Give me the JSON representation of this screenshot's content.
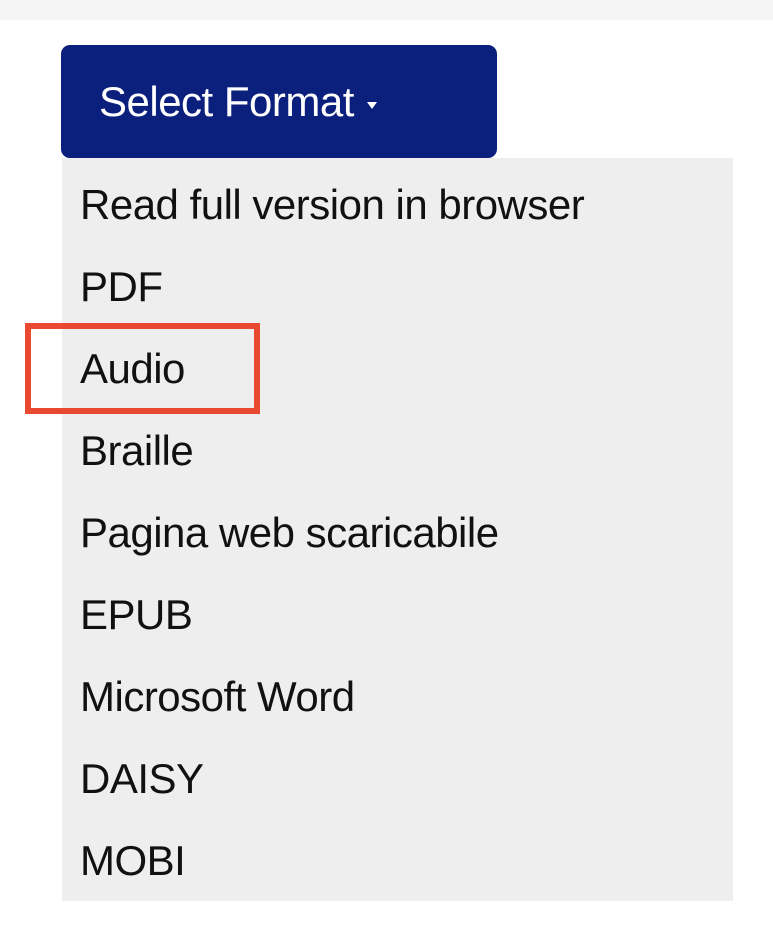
{
  "format_button": {
    "label": "Select Format",
    "caret_icon": "caret-down-icon"
  },
  "format_menu": {
    "items": [
      {
        "label": "Read full version in browser"
      },
      {
        "label": "PDF"
      },
      {
        "label": "Audio",
        "highlighted": true
      },
      {
        "label": "Braille"
      },
      {
        "label": "Pagina web scaricabile"
      },
      {
        "label": "EPUB"
      },
      {
        "label": "Microsoft Word"
      },
      {
        "label": "DAISY"
      },
      {
        "label": "MOBI"
      }
    ]
  },
  "colors": {
    "button_background": "#0b1f7c",
    "button_text": "#ffffff",
    "menu_background": "#eeeeee",
    "highlight_border": "#e8492f"
  }
}
